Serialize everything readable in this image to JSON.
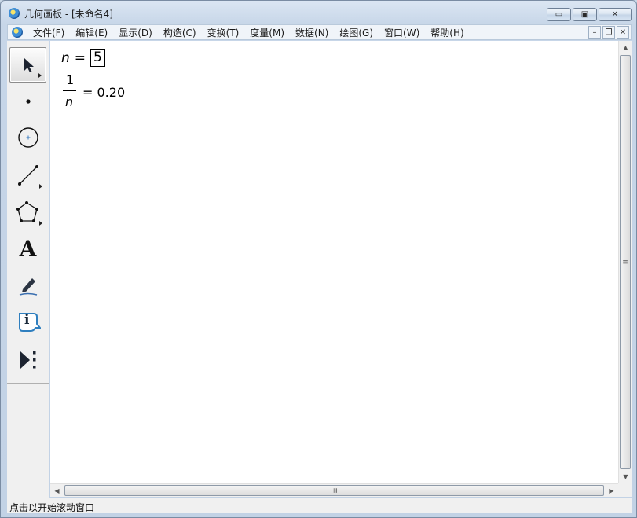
{
  "window": {
    "title": "几何画板 - [未命名4]",
    "minimize_glyph": "▭",
    "maximize_glyph": "▣",
    "close_glyph": "✕"
  },
  "menubar": {
    "items": [
      {
        "label": "文件(F)"
      },
      {
        "label": "编辑(E)"
      },
      {
        "label": "显示(D)"
      },
      {
        "label": "构造(C)"
      },
      {
        "label": "变换(T)"
      },
      {
        "label": "度量(M)"
      },
      {
        "label": "数据(N)"
      },
      {
        "label": "绘图(G)"
      },
      {
        "label": "窗口(W)"
      },
      {
        "label": "帮助(H)"
      }
    ],
    "mdi_minimize": "–",
    "mdi_restore": "❐",
    "mdi_close": "✕"
  },
  "toolbox": {
    "tools": [
      {
        "name": "select-arrow-tool",
        "icon": "arrow-icon",
        "selected": true
      },
      {
        "name": "point-tool",
        "icon": "point-icon"
      },
      {
        "name": "compass-tool",
        "icon": "circle-icon"
      },
      {
        "name": "straightedge-tool",
        "icon": "line-segment-icon"
      },
      {
        "name": "polygon-tool",
        "icon": "pentagon-icon"
      },
      {
        "name": "text-tool",
        "icon": "letter-a-icon",
        "glyph": "A"
      },
      {
        "name": "marker-tool",
        "icon": "marker-pen-icon"
      },
      {
        "name": "information-tool",
        "icon": "info-icon",
        "glyph": "i"
      },
      {
        "name": "custom-tools",
        "icon": "play-menu-icon"
      }
    ]
  },
  "canvas": {
    "param": {
      "name": "n",
      "equals": "=",
      "value": "5"
    },
    "calculation": {
      "numerator": "1",
      "denominator": "n",
      "result": "= 0.20"
    }
  },
  "scrollbars": {
    "grip": "≡",
    "up": "▲",
    "down": "▼",
    "left": "◀",
    "right": "▶"
  },
  "status": {
    "text": "点击以开始滚动窗口"
  },
  "colors": {
    "titlebar": "#c7d6e8",
    "canvas": "#ffffff",
    "marker_accent": "#3a6fb0",
    "info_accent": "#2f7fbf"
  }
}
